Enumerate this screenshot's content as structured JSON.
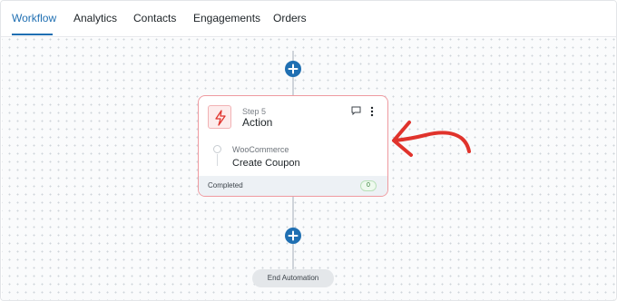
{
  "tabs": [
    {
      "label": "Workflow",
      "active": true
    },
    {
      "label": "Analytics",
      "active": false
    },
    {
      "label": "Contacts",
      "active": false
    },
    {
      "label": "Engagements",
      "active": false
    },
    {
      "label": "Orders",
      "active": false
    }
  ],
  "step_card": {
    "step_label": "Step 5",
    "title": "Action",
    "app": "WooCommerce",
    "action": "Create Coupon",
    "status": "Completed",
    "count": "0"
  },
  "end_button": {
    "label": "End Automation"
  },
  "colors": {
    "accent": "#1f6fb2",
    "card_border": "#ef9aa0",
    "annotation_arrow": "#e0332c",
    "footer_bg": "#edf1f5"
  },
  "icons": {
    "step_icon": "lightning-bolt-icon",
    "comment": "comment-icon",
    "menu": "vertical-dots-menu-icon",
    "add": "plus-circle-icon"
  }
}
